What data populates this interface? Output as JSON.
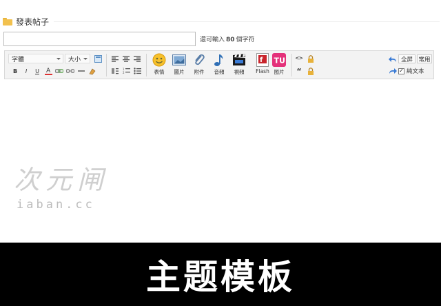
{
  "header": {
    "title": "發表帖子"
  },
  "subject": {
    "value": "",
    "limit_prefix": "還可輸入",
    "limit_count": "80",
    "limit_suffix": "個字符"
  },
  "toolbar": {
    "font_select": "字體",
    "size_select": "大小",
    "buttons": {
      "emoji": "表情",
      "image": "圖片",
      "attachment": "附件",
      "music": "音頻",
      "video": "視頻",
      "flash": "Flash",
      "tu_image": "图片"
    },
    "fullscreen": "全屏",
    "common": "常用",
    "plain_text": "純文本"
  },
  "watermark": {
    "name": "次元闸",
    "url": "iaban.cc"
  },
  "banner": {
    "text": "主题模板"
  }
}
